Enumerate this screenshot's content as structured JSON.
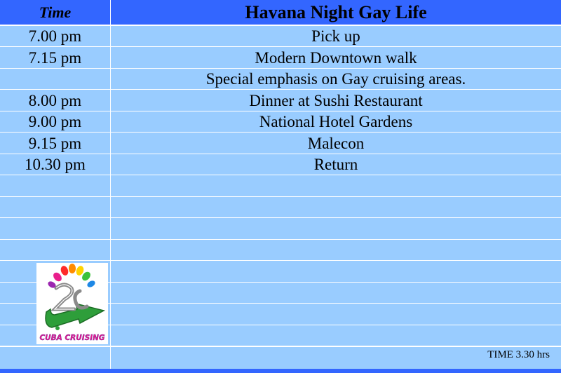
{
  "header": {
    "time_label": "Time",
    "title": "Havana  Night Gay Life"
  },
  "schedule": [
    {
      "time": "7.00 pm",
      "activity": "Pick up"
    },
    {
      "time": "7.15 pm",
      "activity": "Modern Downtown walk"
    },
    {
      "time": "",
      "activity": "Special emphasis on Gay cruising areas."
    },
    {
      "time": "8.00 pm",
      "activity": "Dinner at Sushi Restaurant"
    },
    {
      "time": "9.00 pm",
      "activity": "National Hotel Gardens"
    },
    {
      "time": "9.15 pm",
      "activity": "Malecon"
    },
    {
      "time": "10.30 pm",
      "activity": "Return"
    }
  ],
  "logo": {
    "text": "CUBA CRUISING",
    "icon": "cuba-cruising-logo-icon"
  },
  "footer": {
    "duration": "TIME 3.30 hrs"
  },
  "colors": {
    "header": "#3366ff",
    "body": "#99ccff",
    "lines": "#ffffff"
  }
}
